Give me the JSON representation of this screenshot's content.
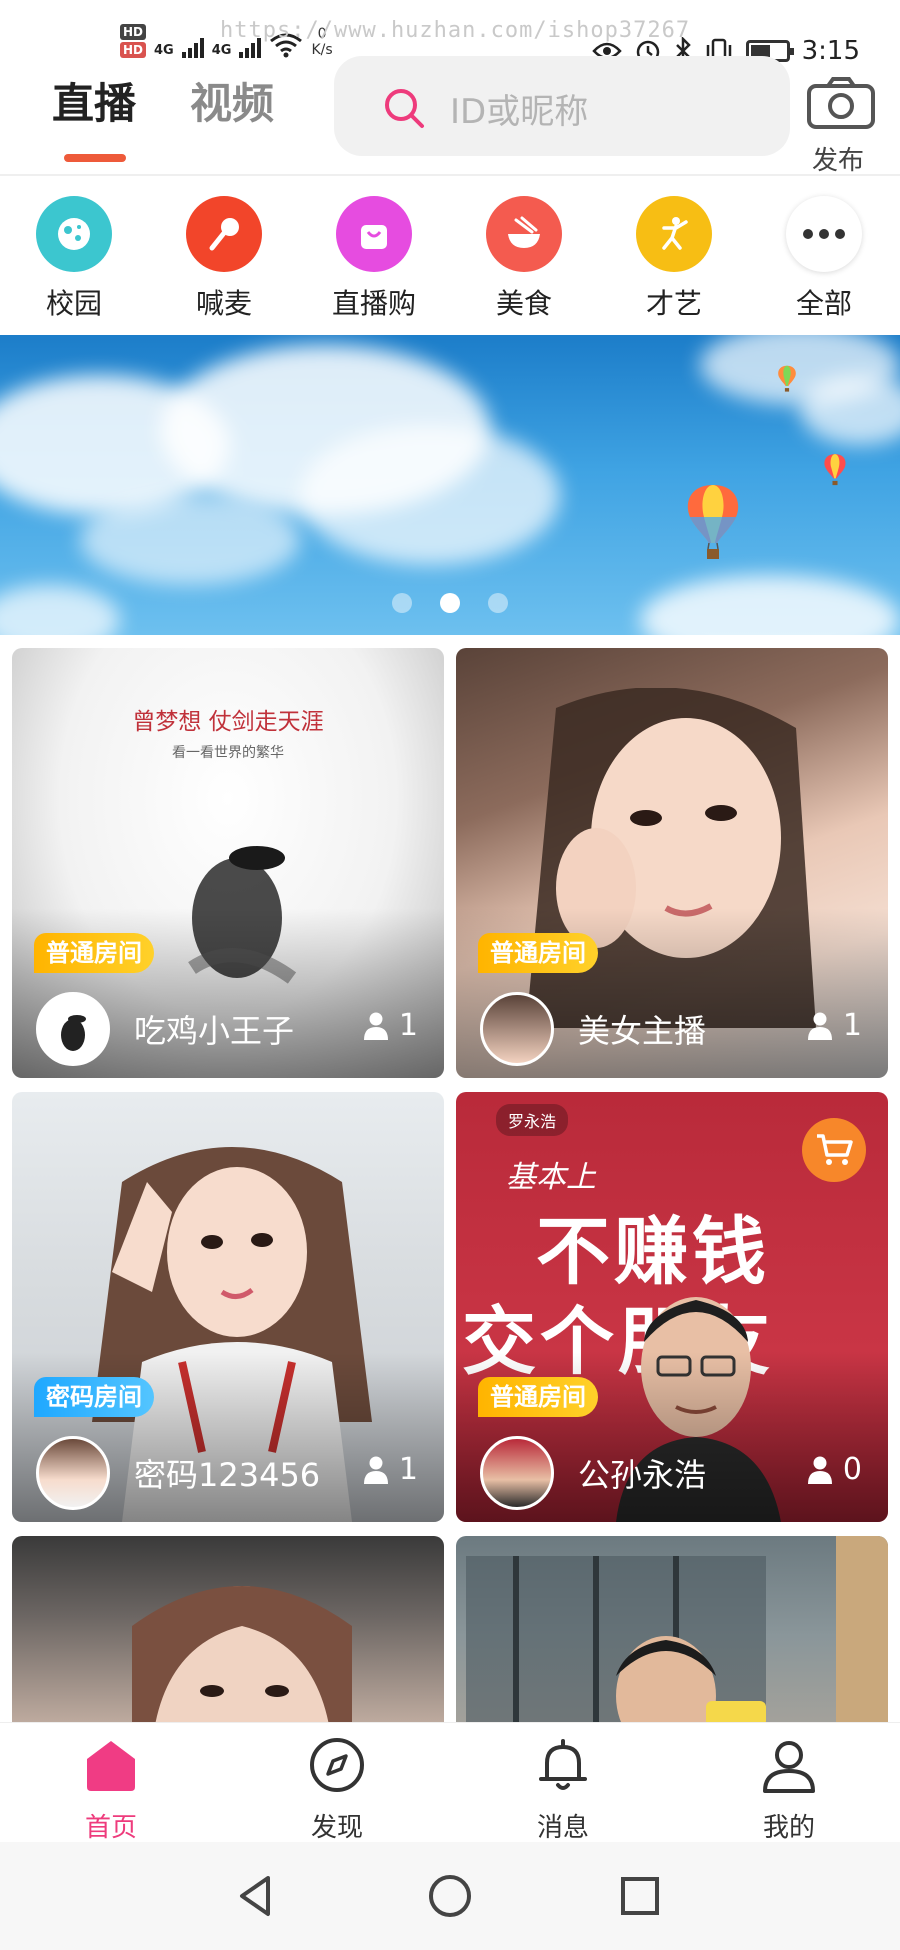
{
  "status_bar": {
    "hd1": "HD",
    "hd2": "HD",
    "net1": "4G",
    "net2": "4G",
    "speed_value": "0",
    "speed_unit": "K/s",
    "watermark": "https://www.huzhan.com/ishop37267",
    "time": "3:15",
    "battery_level": 0.55
  },
  "header": {
    "tabs": [
      {
        "label": "直播",
        "active": true
      },
      {
        "label": "视频",
        "active": false
      }
    ],
    "search_placeholder": "ID或昵称",
    "publish_label": "发布"
  },
  "categories": [
    {
      "label": "校园",
      "icon": "planet-icon",
      "color": "#3cc6cf"
    },
    {
      "label": "喊麦",
      "icon": "microphone-icon",
      "color": "#f2452a"
    },
    {
      "label": "直播购",
      "icon": "shopping-bag-icon",
      "color": "#e64ce0"
    },
    {
      "label": "美食",
      "icon": "bowl-icon",
      "color": "#f45b4f"
    },
    {
      "label": "才艺",
      "icon": "dancer-icon",
      "color": "#f7be14"
    },
    {
      "label": "全部",
      "icon": "more-dots-icon",
      "color": "#ffffff"
    }
  ],
  "banner": {
    "slide_count": 3,
    "active_slide": 2
  },
  "live_rooms": [
    {
      "badge": "普通房间",
      "badge_type": "normal",
      "name": "吃鸡小王子",
      "viewers": "1",
      "cover_text": [
        "曾梦想 仗剑走天涯",
        "看一看世界的繁华"
      ]
    },
    {
      "badge": "普通房间",
      "badge_type": "normal",
      "name": "美女主播",
      "viewers": "1",
      "cover_text": []
    },
    {
      "badge": "密码房间",
      "badge_type": "password",
      "name": "密码123456",
      "viewers": "1",
      "cover_text": []
    },
    {
      "badge": "普通房间",
      "badge_type": "normal",
      "name": "公孙永浩",
      "viewers": "0",
      "cover_text": [
        "罗永浩",
        "基本上",
        "不赚钱",
        "交个朋友"
      ]
    }
  ],
  "bottom_nav": [
    {
      "label": "首页",
      "icon": "home-icon",
      "active": true
    },
    {
      "label": "发现",
      "icon": "compass-icon",
      "active": false
    },
    {
      "label": "消息",
      "icon": "bell-icon",
      "active": false
    },
    {
      "label": "我的",
      "icon": "profile-icon",
      "active": false
    }
  ],
  "colors": {
    "accent": "#ee3b7c",
    "tab_indicator": "#ee5a3a",
    "search_icon": "#ee3b7c"
  }
}
